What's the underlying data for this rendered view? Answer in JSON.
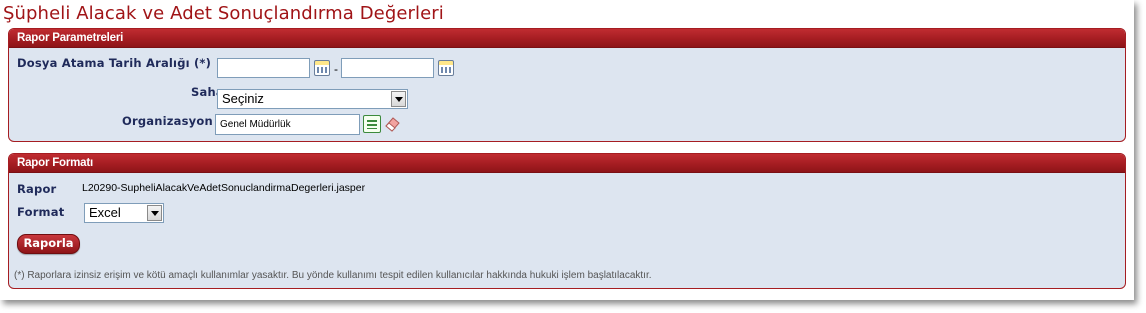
{
  "page": {
    "title": "Şüpheli Alacak ve Adet Sonuçlandırma Değerleri"
  },
  "params_panel": {
    "header": "Rapor Parametreleri",
    "date_range_label": "Dosya Atama Tarih Aralığı (*)",
    "date_from_value": "",
    "date_to_value": "",
    "date_separator": "-",
    "saha_label": "Saha",
    "saha_selected": "Seçiniz",
    "org_label": "Organizasyon",
    "org_value": "Genel Müdürlük"
  },
  "format_panel": {
    "header": "Rapor Formatı",
    "rapor_label": "Rapor",
    "rapor_value": "L20290-SupheliAlacakVeAdetSonuclandirmaDegerleri.jasper",
    "format_label": "Format",
    "format_selected": "Excel",
    "submit_label": "Raporla",
    "footnote": "(*) Raporlara izinsiz erişim ve kötü amaçlı kullanımlar yasaktır. Bu yönde kullanımı tespit edilen kullanıcılar hakkında hukuki işlem başlatılacaktır."
  },
  "icons": {
    "calendar": "calendar-icon",
    "list": "list-select-icon",
    "eraser": "eraser-icon",
    "dropdown": "chevron-down-icon"
  },
  "colors": {
    "brand_red": "#a51d22",
    "panel_bg": "#dde5f0",
    "label_navy": "#1f2a5a"
  }
}
